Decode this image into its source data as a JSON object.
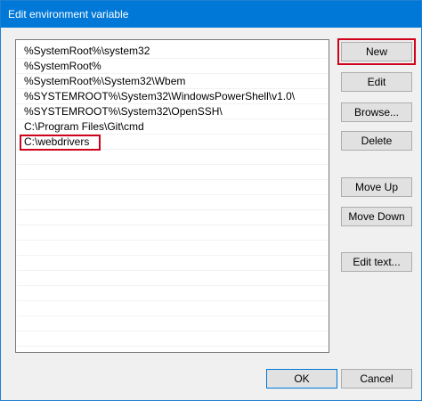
{
  "window": {
    "title": "Edit environment variable"
  },
  "list": {
    "items": [
      "%SystemRoot%\\system32",
      "%SystemRoot%",
      "%SystemRoot%\\System32\\Wbem",
      "%SYSTEMROOT%\\System32\\WindowsPowerShell\\v1.0\\",
      "%SYSTEMROOT%\\System32\\OpenSSH\\",
      "C:\\Program Files\\Git\\cmd",
      "C:\\webdrivers"
    ]
  },
  "buttons": {
    "new": "New",
    "edit": "Edit",
    "browse": "Browse...",
    "delete": "Delete",
    "move_up": "Move Up",
    "move_down": "Move Down",
    "edit_text": "Edit text...",
    "ok": "OK",
    "cancel": "Cancel"
  },
  "colors": {
    "titlebar": "#0078d7",
    "highlight": "#d0021b",
    "button_face": "#e1e1e1"
  }
}
